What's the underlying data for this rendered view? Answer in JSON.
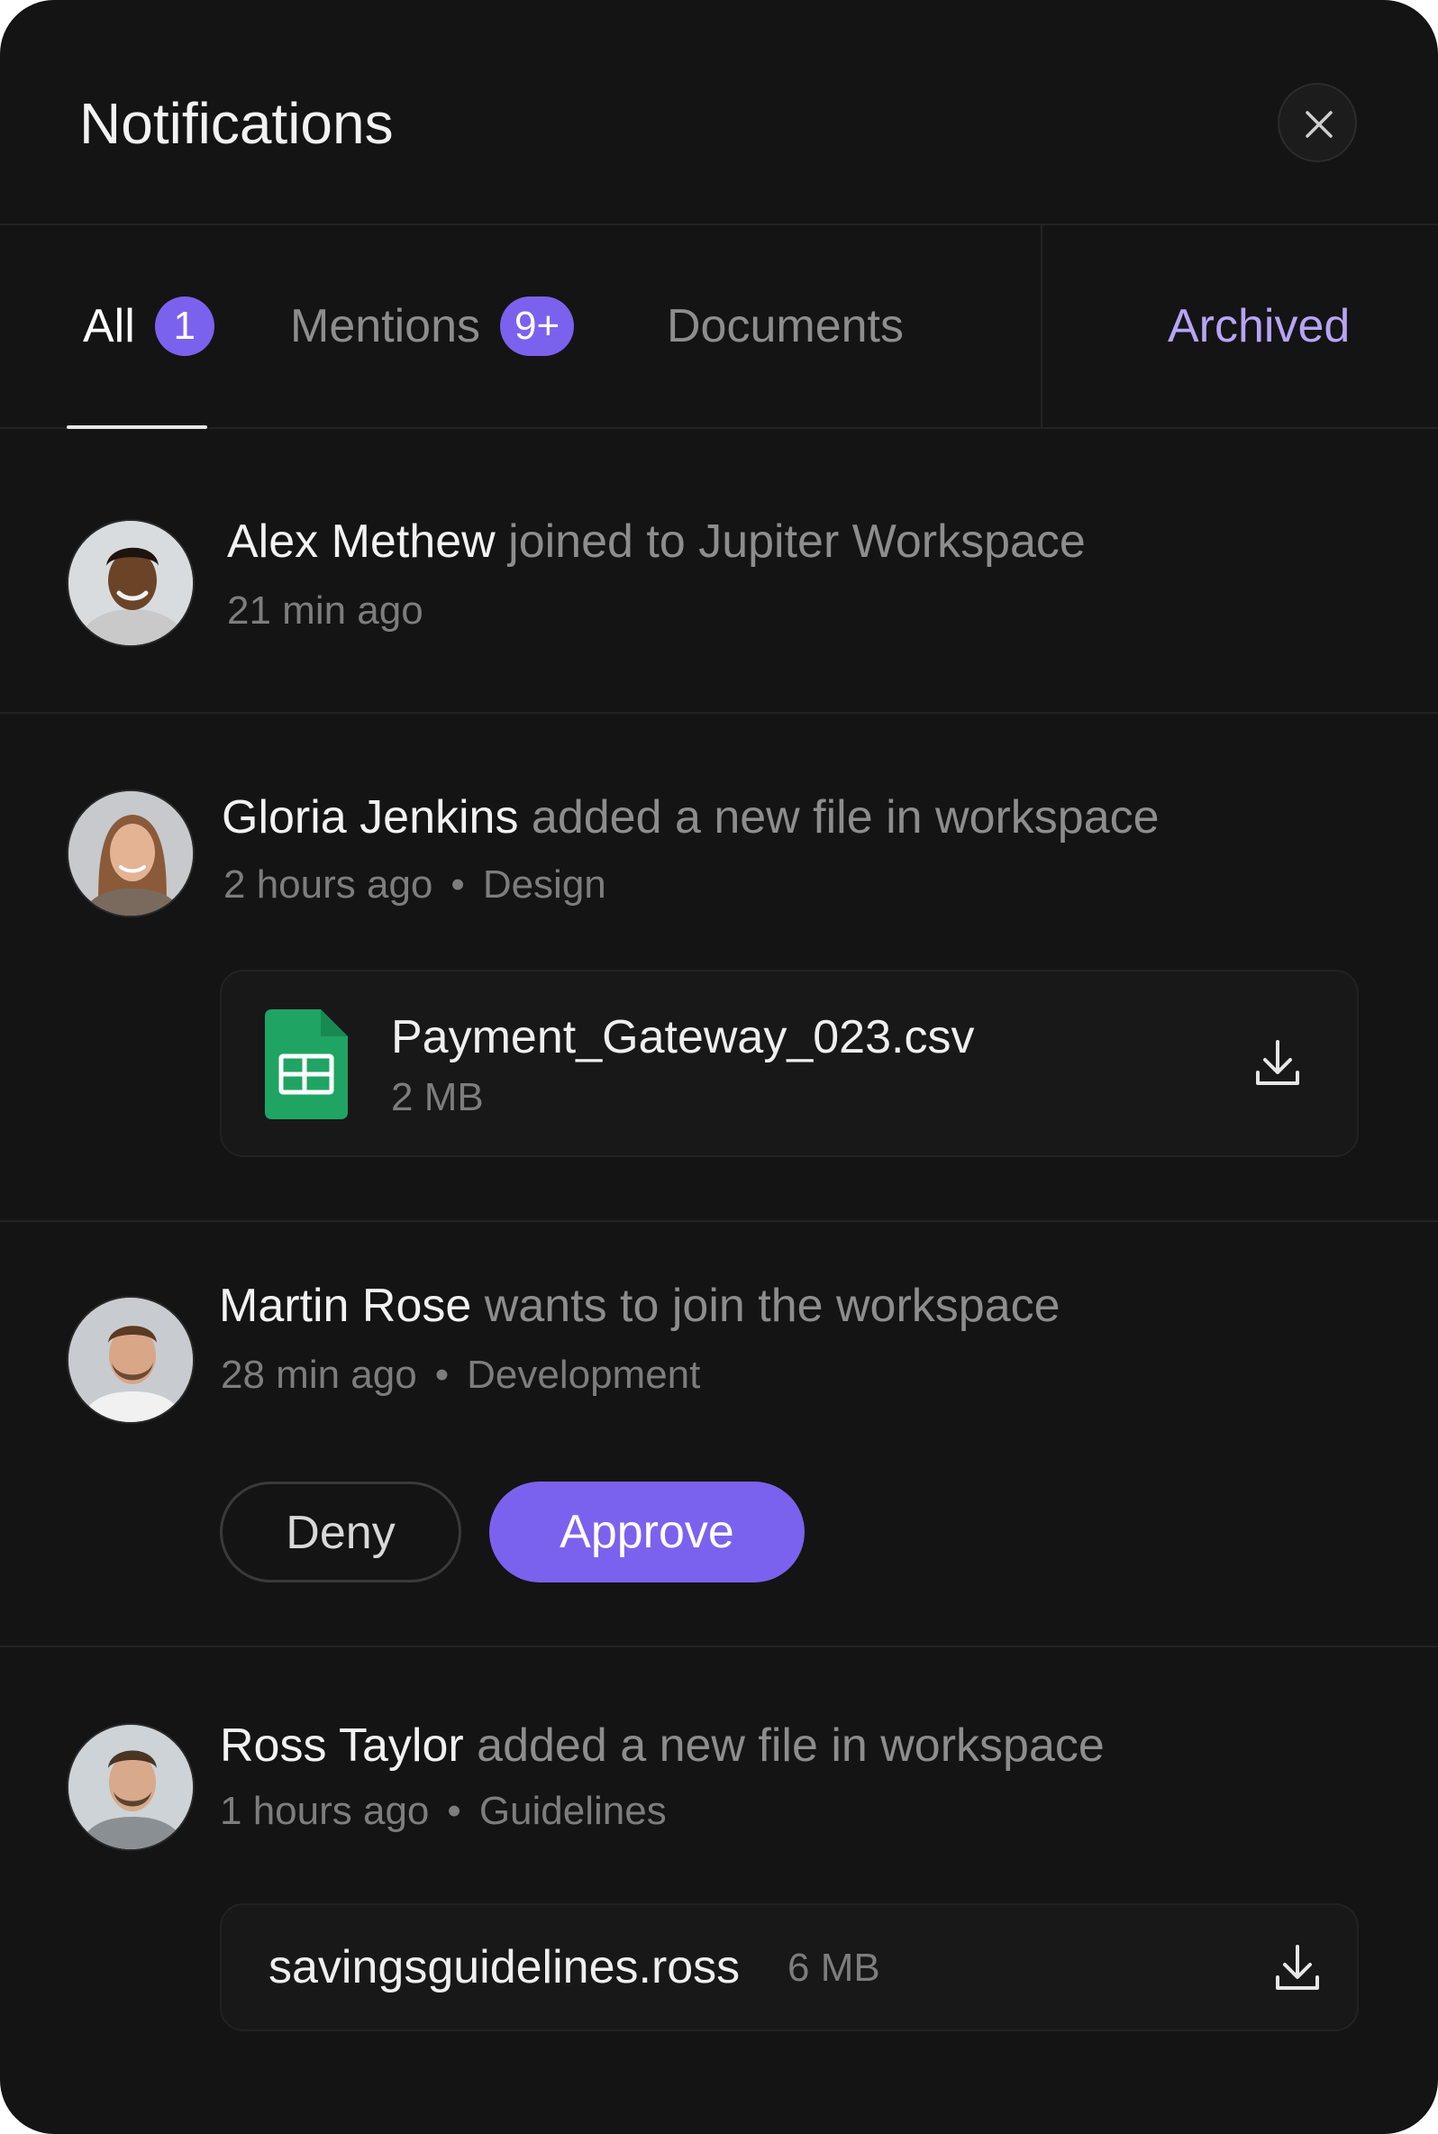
{
  "header": {
    "title": "Notifications",
    "close_icon": "close-icon"
  },
  "tabs": [
    {
      "label": "All",
      "badge": "1",
      "active": true
    },
    {
      "label": "Mentions",
      "badge": "9+"
    },
    {
      "label": "Documents"
    },
    {
      "label": "Archived"
    }
  ],
  "colors": {
    "accent": "#7b62ee",
    "archived": "#b7a4f7",
    "background": "#141414",
    "file_icon": "#1fa463"
  },
  "notifications": [
    {
      "name": "Alex Methew",
      "action": "joined to Jupiter Workspace",
      "time": "21 min ago"
    },
    {
      "name": "Gloria Jenkins",
      "action": "added a new file in workspace",
      "time": "2 hours ago",
      "category": "Design",
      "file": {
        "name": "Payment_Gateway_023.csv",
        "size": "2 MB",
        "icon": "spreadsheet-icon"
      }
    },
    {
      "name": "Martin Rose",
      "action": "wants to join the workspace",
      "time": "28 min ago",
      "category": "Development",
      "actions": {
        "deny": "Deny",
        "approve": "Approve"
      }
    },
    {
      "name": "Ross Taylor",
      "action": "added a new file in workspace",
      "time": "1 hours ago",
      "category": "Guidelines",
      "file": {
        "name": "savingsguidelines.ross",
        "size": "6 MB"
      }
    }
  ]
}
